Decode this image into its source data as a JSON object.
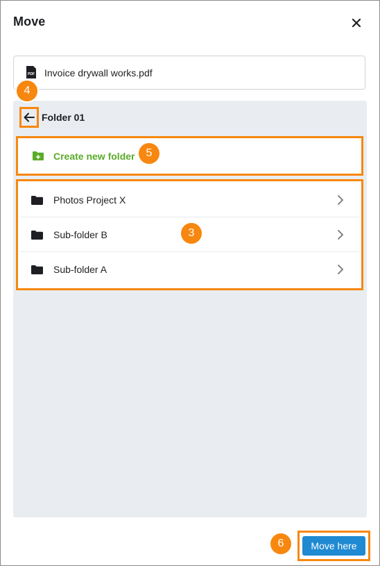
{
  "dialog": {
    "title": "Move",
    "close_icon": "close-icon"
  },
  "file": {
    "name": "Invoice drywall works.pdf",
    "icon": "pdf-file-icon"
  },
  "breadcrumb": {
    "back_icon": "arrow-left-icon",
    "current_folder": "Folder 01"
  },
  "create_folder": {
    "label": "Create new folder",
    "icon": "folder-plus-icon",
    "color": "#5aab2a"
  },
  "folders": [
    {
      "name": "Photos Project X",
      "icon": "folder-icon"
    },
    {
      "name": "Sub-folder B",
      "icon": "folder-icon"
    },
    {
      "name": "Sub-folder A",
      "icon": "folder-icon"
    }
  ],
  "footer": {
    "move_label": "Move here",
    "button_color": "#1f89d2"
  },
  "callouts": {
    "back": "4",
    "create": "5",
    "list": "3",
    "move": "6",
    "color": "#f7870f"
  }
}
